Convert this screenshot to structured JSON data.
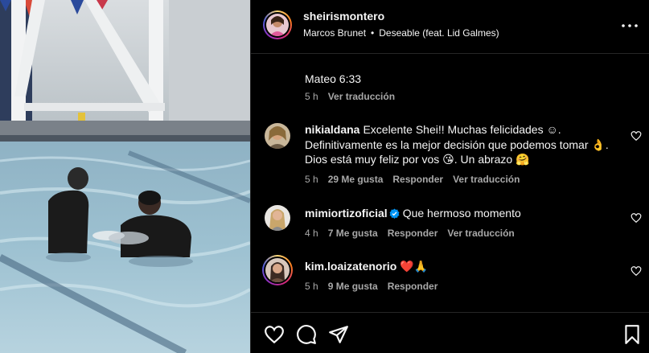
{
  "post": {
    "username": "sheirismontero",
    "song_artist": "Marcos Brunet",
    "song_title": "Deseable (feat. Lid Galmes)",
    "caption_text": "Mateo 6:33",
    "caption_time": "5 h",
    "caption_translate": "Ver traducción"
  },
  "comments": [
    {
      "username": "nikialdana",
      "text": "Excelente Shei!! Muchas felicidades ☺. Definitivamente es la mejor decisión que podemos tomar 👌. Dios está muy feliz por vos 😘. Un abrazo 🤗",
      "time": "5 h",
      "likes": "29 Me gusta",
      "reply": "Responder",
      "translate": "Ver traducción"
    },
    {
      "username": "mimiortizoficial",
      "verified": true,
      "text": "Que hermoso momento",
      "time": "4 h",
      "likes": "7 Me gusta",
      "reply": "Responder",
      "translate": "Ver traducción"
    },
    {
      "username": "kim.loaizatenorio",
      "text": "❤️🙏",
      "time": "5 h",
      "likes": "9 Me gusta",
      "reply": "Responder"
    }
  ],
  "icons": {
    "more": "more-options-icon",
    "like": "heart-icon",
    "comment": "comment-icon",
    "share": "paper-plane-icon",
    "save": "bookmark-icon",
    "verified": "verified-badge-icon"
  },
  "colors": {
    "background": "#000000",
    "text": "#f5f5f5",
    "secondary_text": "#a8a8a8",
    "divider": "#262626",
    "verified": "#0095f6"
  }
}
